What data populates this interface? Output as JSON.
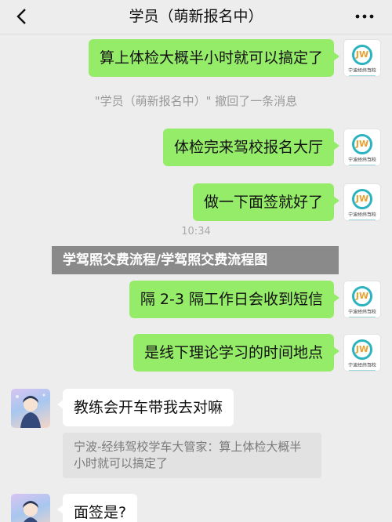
{
  "header": {
    "title": "学员（萌新报名中）",
    "back_icon": "chevron-left-icon",
    "more_icon": "more-dots-icon"
  },
  "shop_avatar": {
    "logo_text": "JW",
    "brand": "宁波经纬驾校"
  },
  "messages": {
    "m1": "算上体检大概半小时就可以搞定了",
    "recall_notice": "\"学员（萌新报名中）\" 撤回了一条消息",
    "m2": "体检完来驾校报名大厅",
    "m3": "做一下面签就好了",
    "timestamp": "10:34",
    "m4": "隔 2-3 隔工作日会收到短信",
    "m5": "是线下理论学习的时间地点",
    "in1": "教练会开车带我去对嘛",
    "quote": "宁波-经纬驾校学车大管家：算上体检大概半小时就可以搞定了",
    "in2": "面签是?"
  },
  "watermark": "学驾照交费流程/学驾照交费流程图",
  "colors": {
    "outgoing_bubble": "#95ec69",
    "incoming_bubble": "#ffffff",
    "background": "#ededed",
    "logo_ring": "#2bb3c0",
    "logo_letters": "#e8a030"
  }
}
